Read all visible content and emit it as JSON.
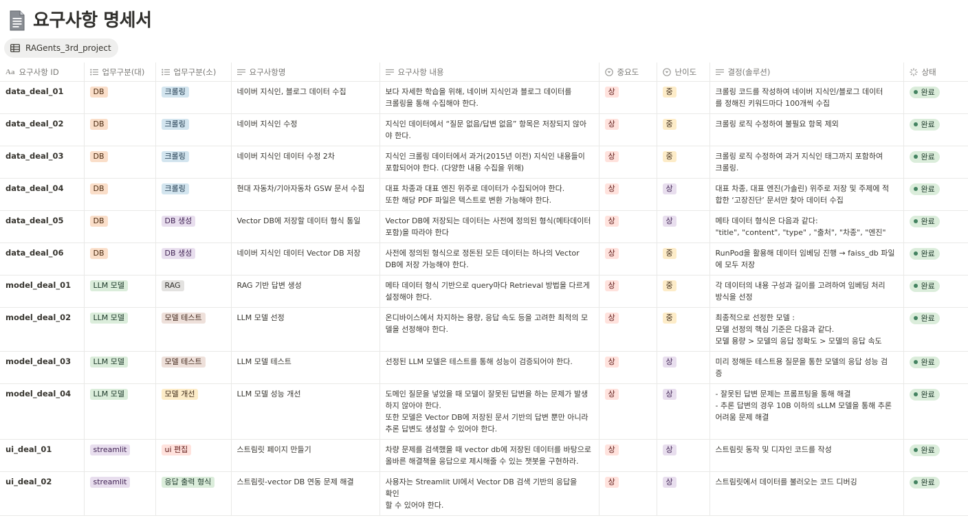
{
  "page": {
    "title": "요구사항 명세서",
    "icon": "page-icon"
  },
  "view": {
    "tab_label": "RAGents_3rd_project",
    "icon": "table-icon"
  },
  "columns": [
    {
      "label": "요구사항 ID",
      "icon": "title-icon"
    },
    {
      "label": "업무구분(대)",
      "icon": "list-icon"
    },
    {
      "label": "업무구분(소)",
      "icon": "list-icon"
    },
    {
      "label": "요구사항명",
      "icon": "text-icon"
    },
    {
      "label": "요구사항 내용",
      "icon": "text-icon"
    },
    {
      "label": "중요도",
      "icon": "select-icon"
    },
    {
      "label": "난이도",
      "icon": "select-icon"
    },
    {
      "label": "결정(솔루션)",
      "icon": "text-icon"
    },
    {
      "label": "상태",
      "icon": "status-icon"
    }
  ],
  "colors": {
    "orange": "#fadec9",
    "blue": "#d3e5ef",
    "purple": "#e8deee",
    "green": "#dbeddb",
    "gray": "#e3e2e0",
    "yellow": "#fdecc8",
    "red": "#ffe2dd",
    "brown": "#eee0da",
    "status_dot": "#448361"
  },
  "rows": [
    {
      "id": "data_deal_01",
      "cat_major": {
        "label": "DB",
        "color": "orange"
      },
      "cat_minor": {
        "label": "크롤링",
        "color": "blue"
      },
      "name": "네이버 지식인, 블로그 데이터 수집",
      "content": [
        "보다 자세한 학습을 위해, 네이버 지식인과 블로그 데이터를",
        "크롤링을 통해 수집해야 한다."
      ],
      "importance": {
        "label": "상",
        "color": "red"
      },
      "difficulty": {
        "label": "중",
        "color": "yellow"
      },
      "solution": [
        "크롤링 코드를 작성하여 네이버 지식인/블로그 데이터",
        "를 정해진 키워드마다 100개씩 수집"
      ],
      "status": "완료"
    },
    {
      "id": "data_deal_02",
      "cat_major": {
        "label": "DB",
        "color": "orange"
      },
      "cat_minor": {
        "label": "크롤링",
        "color": "blue"
      },
      "name": "네이버 지식인 수정",
      "content": [
        "지식인 데이터에서 “질문 없음/답변 없음” 항목은 저장되지 않아",
        "야 한다."
      ],
      "importance": {
        "label": "상",
        "color": "red"
      },
      "difficulty": {
        "label": "중",
        "color": "yellow"
      },
      "solution": [
        "크롤링 로직 수정하여 불필요 항목 제외"
      ],
      "status": "완료"
    },
    {
      "id": "data_deal_03",
      "cat_major": {
        "label": "DB",
        "color": "orange"
      },
      "cat_minor": {
        "label": "크롤링",
        "color": "blue"
      },
      "name": "네이버 지식인 데이터 수정 2차",
      "content": [
        "지식인 크롤링 데이터에서 과거(2015년 이전) 지식인 내용들이",
        "포함되어야 한다. (다양한 내용 수집을 위해)"
      ],
      "importance": {
        "label": "상",
        "color": "red"
      },
      "difficulty": {
        "label": "중",
        "color": "yellow"
      },
      "solution": [
        "크롤링 로직 수정하여 과거 지식인 태그까지 포함하여",
        "크롤링."
      ],
      "status": "완료"
    },
    {
      "id": "data_deal_04",
      "cat_major": {
        "label": "DB",
        "color": "orange"
      },
      "cat_minor": {
        "label": "크롤링",
        "color": "blue"
      },
      "name": "현대 자동차/기아자동차 GSW 문서 수집",
      "content": [
        "대표 차종과 대표 엔진 위주로 데이터가 수집되어야 한다.",
        "또한 해당 PDF 파일은 텍스트로 변환 가능해야 한다."
      ],
      "importance": {
        "label": "상",
        "color": "red"
      },
      "difficulty": {
        "label": "상",
        "color": "purple"
      },
      "solution": [
        "대표 차종, 대표 엔진(가솔린) 위주로 저장 및 주제에 적",
        "합한 ‘고장진단’ 문서만 찾아 데이터 수집"
      ],
      "status": "완료"
    },
    {
      "id": "data_deal_05",
      "cat_major": {
        "label": "DB",
        "color": "orange"
      },
      "cat_minor": {
        "label": "DB 생성",
        "color": "purple"
      },
      "name": "Vector DB에 저장할 데이터 형식 통일",
      "content": [
        "Vector DB에 저장되는 데이터는 사전에 정의된 형식(메타데이터",
        "포함)을 따라야 한다"
      ],
      "importance": {
        "label": "상",
        "color": "red"
      },
      "difficulty": {
        "label": "상",
        "color": "purple"
      },
      "solution": [
        "메타 데이터 형식은 다음과 같다:",
        "\"title\", \"content\", \"type\" , \"출처\", \"차종\", \"엔진\""
      ],
      "status": "완료"
    },
    {
      "id": "data_deal_06",
      "cat_major": {
        "label": "DB",
        "color": "orange"
      },
      "cat_minor": {
        "label": "DB 생성",
        "color": "purple"
      },
      "name": "네이버 지식인 데이터 Vector DB 저장",
      "content": [
        "사전에 정의된 형식으로 정돈된 모든 데이터는 하나의 Vector",
        "DB에 저장 가능해야 한다."
      ],
      "importance": {
        "label": "상",
        "color": "red"
      },
      "difficulty": {
        "label": "중",
        "color": "yellow"
      },
      "solution": [
        "RunPod을 활용해 데이터 임베딩 진행 → faiss_db 파일",
        "에 모두 저장"
      ],
      "status": "완료"
    },
    {
      "id": "model_deal_01",
      "cat_major": {
        "label": "LLM 모델",
        "color": "green"
      },
      "cat_minor": {
        "label": "RAG",
        "color": "gray"
      },
      "name": "RAG 기반 답변 생성",
      "content": [
        "메타 데이터 형식 기반으로 query마다 Retrieval 방법을 다르게",
        "설정해야 한다."
      ],
      "importance": {
        "label": "상",
        "color": "red"
      },
      "difficulty": {
        "label": "중",
        "color": "yellow"
      },
      "solution": [
        "각 데이터의 내용 구성과 길이를 고려하여 임베딩 처리",
        "방식을 선정"
      ],
      "status": "완료"
    },
    {
      "id": "model_deal_02",
      "cat_major": {
        "label": "LLM 모델",
        "color": "green"
      },
      "cat_minor": {
        "label": "모델 테스트",
        "color": "brown"
      },
      "name": "LLM 모델 선정",
      "content": [
        "온디바이스에서 차지하는 용량, 응답 속도 등을 고려한 최적의 모",
        "델을 선정해야 한다."
      ],
      "importance": {
        "label": "상",
        "color": "red"
      },
      "difficulty": {
        "label": "중",
        "color": "yellow"
      },
      "solution": [
        "최종적으로 선정한 모델 :",
        "모델 선정의 핵심 기준은 다음과 같다.",
        "모델 용량 > 모델의 응답 정확도 > 모델의 응답 속도"
      ],
      "status": "완료"
    },
    {
      "id": "model_deal_03",
      "cat_major": {
        "label": "LLM 모델",
        "color": "green"
      },
      "cat_minor": {
        "label": "모델 테스트",
        "color": "brown"
      },
      "name": "LLM 모델 테스트",
      "content": [
        "선정된 LLM 모델은 테스트를 통해 성능이 검증되어야 한다."
      ],
      "importance": {
        "label": "상",
        "color": "red"
      },
      "difficulty": {
        "label": "상",
        "color": "purple"
      },
      "solution": [
        "미리 정해둔 테스트용 질문을 통한 모델의 응답 성능 검",
        "증"
      ],
      "status": "완료"
    },
    {
      "id": "model_deal_04",
      "cat_major": {
        "label": "LLM 모델",
        "color": "green"
      },
      "cat_minor": {
        "label": "모델 개선",
        "color": "yellow"
      },
      "name": "LLM 모델 성능 개선",
      "content": [
        "도메인 질문을 넣었을 때 모델이 잘못된 답변을 하는 문제가 발생",
        "하지 않아야 한다.",
        "또한 모델은 Vector DB에 저장된 문서 기반의 답변 뿐만 아니라",
        "추론 답변도 생성할 수 있어야 한다."
      ],
      "importance": {
        "label": "상",
        "color": "red"
      },
      "difficulty": {
        "label": "상",
        "color": "purple"
      },
      "solution": [
        "- 잘못된 답변 문제는 프롬프팅을 통해 해결",
        "- 추론 답변의 경우 10B 이하의 sLLM 모델을 통해 추론",
        "어려움 문제 해결"
      ],
      "status": "완료"
    },
    {
      "id": "ui_deal_01",
      "cat_major": {
        "label": "streamlit",
        "color": "purple"
      },
      "cat_minor": {
        "label": "ui 편집",
        "color": "red"
      },
      "name": "스트림릿 페이지 만들기",
      "content": [
        "차량 문제를 검색했을 때 vector db에 저장된 데이터를 바탕으로",
        "올바른 해결책을 응답으로 제시해줄 수 있는 챗봇을 구현하라."
      ],
      "importance": {
        "label": "상",
        "color": "red"
      },
      "difficulty": {
        "label": "상",
        "color": "purple"
      },
      "solution": [
        "스트림릿 동작 및 디자인 코드를 작성"
      ],
      "status": "완료"
    },
    {
      "id": "ui_deal_02",
      "cat_major": {
        "label": "streamlit",
        "color": "purple"
      },
      "cat_minor": {
        "label": "응답 출력 형식",
        "color": "green"
      },
      "name": "스트림릿-vector DB 연동 문제 해결",
      "content": [
        "사용자는 Streamlit UI에서 Vector DB 검색 기반의 응답을 확인",
        "할 수 있어야 한다."
      ],
      "importance": {
        "label": "상",
        "color": "red"
      },
      "difficulty": {
        "label": "상",
        "color": "purple"
      },
      "solution": [
        "스트림릿에서 데이터를 불러오는 코드 디버깅"
      ],
      "status": "완료"
    }
  ]
}
